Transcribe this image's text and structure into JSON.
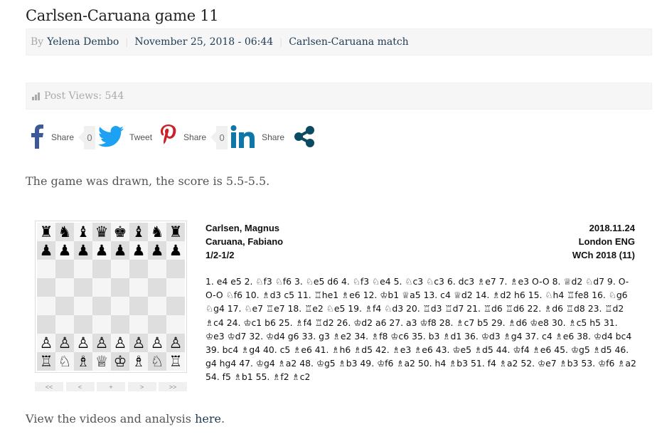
{
  "post": {
    "title": "Carlsen-Caruana game 11",
    "meta": {
      "by_label": "By",
      "author": "Yelena Dembo",
      "date": "November 25, 2018 - 06:44",
      "category": "Carlsen-Caruana match",
      "separator": "|"
    },
    "views": {
      "icon": "bar-chart-icon",
      "label": "Post Views: 544"
    }
  },
  "share": [
    {
      "network": "facebook",
      "icon": "facebook-icon",
      "label": "Share",
      "count": "0",
      "color": "#3b5998"
    },
    {
      "network": "twitter",
      "icon": "twitter-icon",
      "label": "Tweet",
      "count": null,
      "color": "#1da1f2"
    },
    {
      "network": "pinterest",
      "icon": "pinterest-icon",
      "label": "Share",
      "count": "0",
      "color": "#cb2027"
    },
    {
      "network": "linkedin",
      "icon": "linkedin-icon",
      "label": "Share",
      "count": null,
      "color": "#0e76a8"
    },
    {
      "network": "more",
      "icon": "share-icon",
      "label": null,
      "count": null,
      "color": "#0b4a63"
    }
  ],
  "intro_text": "The game was drawn, the score is 5.5-5.5.",
  "board": {
    "ranks": [
      [
        "r",
        "n",
        "b",
        "q",
        "k",
        "b",
        "n",
        "r"
      ],
      [
        "p",
        "p",
        "p",
        "p",
        "p",
        "p",
        "p",
        "p"
      ],
      [
        "",
        "",
        "",
        "",
        "",
        "",
        "",
        ""
      ],
      [
        "",
        "",
        "",
        "",
        "",
        "",
        "",
        ""
      ],
      [
        "",
        "",
        "",
        "",
        "",
        "",
        "",
        ""
      ],
      [
        "",
        "",
        "",
        "",
        "",
        "",
        "",
        ""
      ],
      [
        "P",
        "P",
        "P",
        "P",
        "P",
        "P",
        "P",
        "P"
      ],
      [
        "R",
        "N",
        "B",
        "Q",
        "K",
        "B",
        "N",
        "R"
      ]
    ],
    "nav": [
      "<<",
      "<",
      "+",
      ">",
      ">>"
    ]
  },
  "game": {
    "white": "Carlsen, Magnus",
    "black": "Caruana, Fabiano",
    "result": "1/2-1/2",
    "date": "2018.11.24",
    "site": "London ENG",
    "event": "WCh 2018 (11)",
    "moves": "1. e4 e5 2. ♘f3 ♘f6 3. ♘e5 d6 4. ♘f3 ♘e4 5. ♘c3 ♘c3 6. dc3 ♗e7 7. ♗e3 O-O 8. ♕d2 ♘d7 9. O-O-O ♘f6 10. ♗d3 c5 11. ♖he1 ♗e6 12. ♔b1 ♕a5 13. c4 ♕d2 14. ♗d2 h6 15. ♘h4 ♖fe8 16. ♘g6 ♘g4 17. ♘e7 ♖e7 18. ♖e2 ♘e5 19. ♗f4 ♘d3 20. ♖d3 ♖d7 21. ♖d6 ♖d6 22. ♗d6 ♖d8 23. ♖d2 ♗c4 24. ♔c1 b6 25. ♗f4 ♖d2 26. ♔d2 a6 27. a3 ♔f8 28. ♗c7 b5 29. ♗d6 ♔e8 30. ♗c5 h5 31. ♔e3 ♔d7 32. ♔d4 g6 33. g3 ♗e2 34. ♗f8 ♔c6 35. b3 ♗d1 36. ♔d3 ♗g4 37. c4 ♗e6 38. ♔d4 bc4 39. bc4 ♗g4 40. c5 ♗e6 41. ♗h6 ♗d5 42. ♗e3 ♗e6 43. ♔e5 ♗d5 44. ♔f4 ♗e6 45. ♔g5 ♗d5 46. g4 hg4 47. ♔g4 ♗a2 48. ♔g5 ♗b3 49. ♔f6 ♗a2 50. h4 ♗b3 51. f4 ♗a2 52. ♔e7 ♗b3 53. ♔f6 ♗a2 54. f5 ♗b1 55. ♗f2 ♗c2"
  },
  "outro": {
    "text": "View the videos and analysis ",
    "link": "here",
    "end": "."
  }
}
